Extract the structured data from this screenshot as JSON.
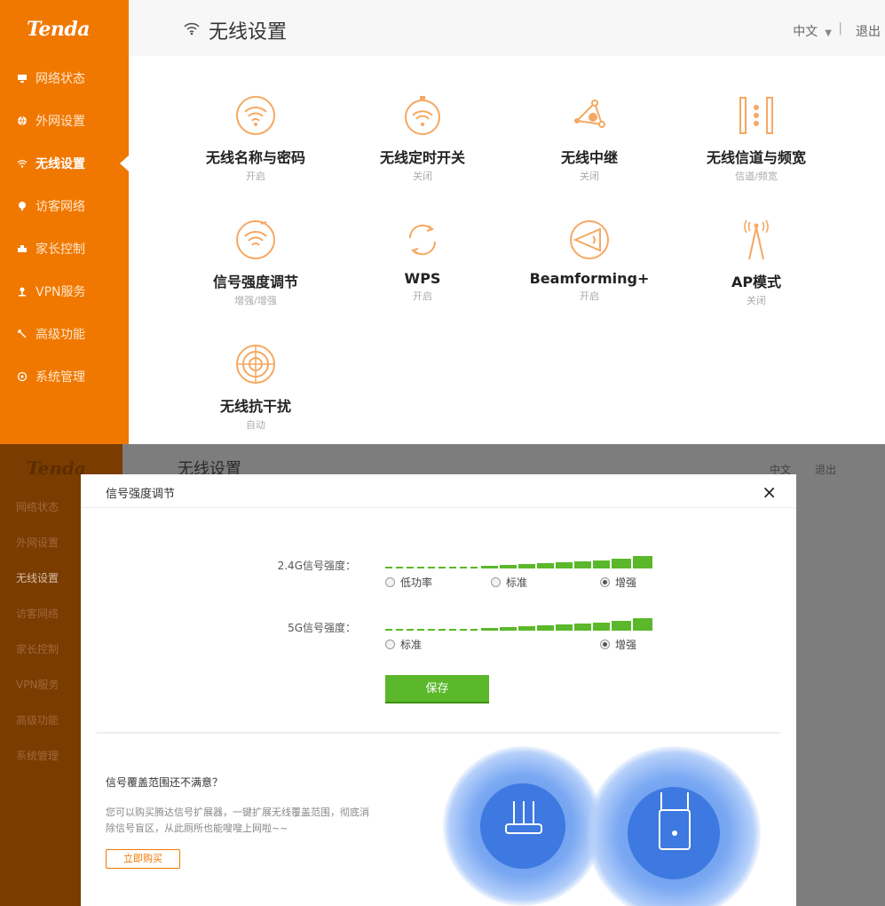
{
  "app": {
    "logo": "Tenda"
  },
  "sidebar": {
    "items": [
      {
        "label": "网络状态",
        "icon": "monitor-icon"
      },
      {
        "label": "外网设置",
        "icon": "globe-icon"
      },
      {
        "label": "无线设置",
        "icon": "wifi-icon",
        "active": true
      },
      {
        "label": "访客网络",
        "icon": "guest-icon"
      },
      {
        "label": "家长控制",
        "icon": "parental-icon"
      },
      {
        "label": "VPN服务",
        "icon": "vpn-icon"
      },
      {
        "label": "高级功能",
        "icon": "tools-icon"
      },
      {
        "label": "系统管理",
        "icon": "settings-icon"
      }
    ]
  },
  "header": {
    "title": "无线设置",
    "language": "中文",
    "logout": "退出"
  },
  "tiles": [
    {
      "name": "无线名称与密码",
      "state": "开启",
      "icon": "wifi-circle-icon"
    },
    {
      "name": "无线定时开关",
      "state": "关闭",
      "icon": "wifi-timer-icon"
    },
    {
      "name": "无线中继",
      "state": "关闭",
      "icon": "repeater-icon"
    },
    {
      "name": "无线信道与频宽",
      "state": "信道/频宽",
      "icon": "channel-icon"
    },
    {
      "name": "信号强度调节",
      "state": "增强/增强",
      "icon": "signal-strength-icon"
    },
    {
      "name": "WPS",
      "state": "开启",
      "icon": "wps-icon"
    },
    {
      "name": "Beamforming+",
      "state": "开启",
      "icon": "beamforming-icon"
    },
    {
      "name": "AP模式",
      "state": "关闭",
      "icon": "ap-tower-icon"
    },
    {
      "name": "无线抗干扰",
      "state": "自动",
      "icon": "anti-interference-icon"
    }
  ],
  "modal": {
    "title": "信号强度调节",
    "close": "×",
    "band24": {
      "label": "2.4G信号强度：",
      "options": [
        "低功率",
        "标准",
        "增强"
      ],
      "selected": "增强"
    },
    "band5": {
      "label": "5G信号强度：",
      "options": [
        "标准",
        "增强"
      ],
      "selected": "增强"
    },
    "save": "保存",
    "promo_question": "信号覆盖范围还不满意？",
    "promo_text": "您可以购买腾达信号扩展器，一键扩展无线覆盖范围，彻底消除信号盲区，从此厕所也能嗖嗖上网啦~~",
    "buy": "立即购买"
  },
  "colors": {
    "brand": "#f07800",
    "accent_green": "#5ab82a",
    "icon_orange": "#f5a862"
  }
}
